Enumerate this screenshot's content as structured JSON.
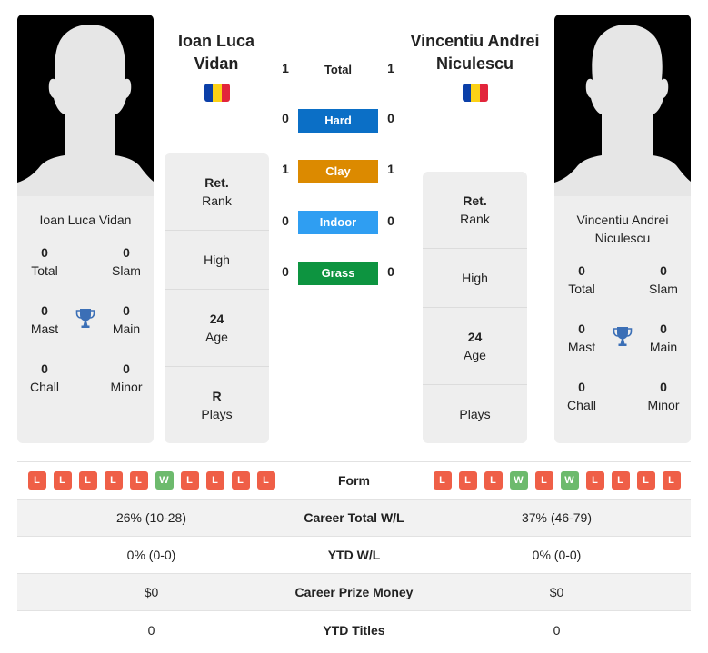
{
  "colors": {
    "hard": "#0b6fc6",
    "clay": "#dc8a00",
    "indoor": "#2f9ef2",
    "grass": "#0d9440",
    "win": "#6dba6d",
    "loss": "#ef5f47",
    "trophy": "#3b6fb6",
    "flag_blue": "#0b3fa8",
    "flag_yellow": "#fcd116",
    "flag_red": "#e2253b"
  },
  "player1": {
    "name": "Ioan Luca Vidan",
    "heading_line1": "Ioan Luca",
    "heading_line2": "Vidan",
    "country_flag": "romania-flag",
    "titles": {
      "total": {
        "value": "0",
        "label": "Total"
      },
      "slam": {
        "value": "0",
        "label": "Slam"
      },
      "mast": {
        "value": "0",
        "label": "Mast"
      },
      "main": {
        "value": "0",
        "label": "Main"
      },
      "chall": {
        "value": "0",
        "label": "Chall"
      },
      "minor": {
        "value": "0",
        "label": "Minor"
      }
    },
    "info": {
      "rank": {
        "value": "Ret.",
        "label": "Rank"
      },
      "high": {
        "value": "",
        "label": "High"
      },
      "age": {
        "value": "24",
        "label": "Age"
      },
      "plays": {
        "value": "R",
        "label": "Plays"
      }
    },
    "form": [
      "L",
      "L",
      "L",
      "L",
      "L",
      "W",
      "L",
      "L",
      "L",
      "L"
    ],
    "career_wl": "26% (10-28)",
    "ytd_wl": "0% (0-0)",
    "prize_money": "$0",
    "ytd_titles": "0"
  },
  "player2": {
    "name_line1": "Vincentiu Andrei",
    "name_line2": "Niculescu",
    "heading_line1": "Vincentiu Andrei",
    "heading_line2": "Niculescu",
    "country_flag": "romania-flag",
    "titles": {
      "total": {
        "value": "0",
        "label": "Total"
      },
      "slam": {
        "value": "0",
        "label": "Slam"
      },
      "mast": {
        "value": "0",
        "label": "Mast"
      },
      "main": {
        "value": "0",
        "label": "Main"
      },
      "chall": {
        "value": "0",
        "label": "Chall"
      },
      "minor": {
        "value": "0",
        "label": "Minor"
      }
    },
    "info": {
      "rank": {
        "value": "Ret.",
        "label": "Rank"
      },
      "high": {
        "value": "",
        "label": "High"
      },
      "age": {
        "value": "24",
        "label": "Age"
      },
      "plays": {
        "value": "",
        "label": "Plays"
      }
    },
    "form": [
      "L",
      "L",
      "L",
      "W",
      "L",
      "W",
      "L",
      "L",
      "L",
      "L"
    ],
    "career_wl": "37% (46-79)",
    "ytd_wl": "0% (0-0)",
    "prize_money": "$0",
    "ytd_titles": "0"
  },
  "h2h": {
    "total": {
      "label": "Total",
      "p1": "1",
      "p2": "1"
    },
    "hard": {
      "label": "Hard",
      "p1": "0",
      "p2": "0"
    },
    "clay": {
      "label": "Clay",
      "p1": "1",
      "p2": "1"
    },
    "indoor": {
      "label": "Indoor",
      "p1": "0",
      "p2": "0"
    },
    "grass": {
      "label": "Grass",
      "p1": "0",
      "p2": "0"
    }
  },
  "stats_labels": {
    "form": "Form",
    "career_wl": "Career Total W/L",
    "ytd_wl": "YTD W/L",
    "prize_money": "Career Prize Money",
    "ytd_titles": "YTD Titles"
  }
}
